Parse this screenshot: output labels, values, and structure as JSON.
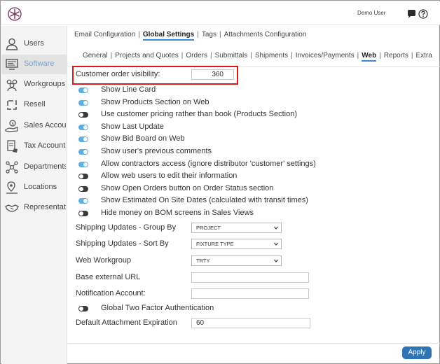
{
  "header": {
    "logo_icon": "asterisk-logo-icon",
    "user_name": "Demo User",
    "chat_icon": "chat-bubble-icon",
    "help_icon": "help-circle-icon"
  },
  "sidebar": {
    "items": [
      {
        "label": "Users",
        "icon": "user-icon"
      },
      {
        "label": "Software",
        "icon": "monitor-icon",
        "active": true
      },
      {
        "label": "Workgroups",
        "icon": "group-icon"
      },
      {
        "label": "Resell",
        "icon": "cycle-icon"
      },
      {
        "label": "Sales Accounts",
        "icon": "money-hand-icon"
      },
      {
        "label": "Tax Accounts",
        "icon": "tax-document-icon"
      },
      {
        "label": "Departments",
        "icon": "network-icon"
      },
      {
        "label": "Locations",
        "icon": "map-pin-icon"
      },
      {
        "label": "Representatives",
        "icon": "handshake-icon"
      }
    ]
  },
  "tabs_primary": [
    "Email Configuration",
    "Global Settings",
    "Tags",
    "Attachments Configuration"
  ],
  "tabs_primary_active": "Global Settings",
  "tabs_secondary": [
    "General",
    "Projects and Quotes",
    "Orders",
    "Submittals",
    "Shipments",
    "Invoices/Payments",
    "Web",
    "Reports",
    "Extra"
  ],
  "tabs_secondary_active": "Web",
  "customer_order_visibility": {
    "label": "Customer order visibility:",
    "value": "360"
  },
  "toggles": [
    {
      "label": "Show Line Card",
      "on": true
    },
    {
      "label": "Show Products Section on Web",
      "on": true
    },
    {
      "label": "Use customer pricing rather than book (Products Section)",
      "on": false
    },
    {
      "label": "Show Last Update",
      "on": true
    },
    {
      "label": "Show Bid Board on Web",
      "on": true
    },
    {
      "label": "Show user's previous comments",
      "on": true
    },
    {
      "label": "Allow contractors access (ignore distributor 'customer' settings)",
      "on": true
    },
    {
      "label": "Allow web users to edit their information",
      "on": false
    },
    {
      "label": "Show Open Orders button on Order Status section",
      "on": false
    },
    {
      "label": "Show Estimated On Site Dates (calculated with transit times)",
      "on": true
    },
    {
      "label": "Hide money on BOM screens in Sales Views",
      "on": false
    }
  ],
  "selects": [
    {
      "label": "Shipping Updates - Group By",
      "value": "PROJECT"
    },
    {
      "label": "Shipping Updates - Sort By",
      "value": "FIXTURE TYPE"
    },
    {
      "label": "Web Workgroup",
      "value": "TRTY"
    }
  ],
  "base_external_url": {
    "label": "Base external URL",
    "value": ""
  },
  "notification_account": {
    "label": "Notification Account:",
    "value": ""
  },
  "two_factor": {
    "label": "Global Two Factor Authentication",
    "on": false
  },
  "attachment_expiration": {
    "label": "Default Attachment Expiration",
    "value": "60"
  },
  "apply_label": "Apply",
  "colors": {
    "accent": "#5dade2",
    "apply_button": "#2f74b5",
    "highlight_box": "#e0161b",
    "active_sidebar_text": "#7fa1c4"
  }
}
